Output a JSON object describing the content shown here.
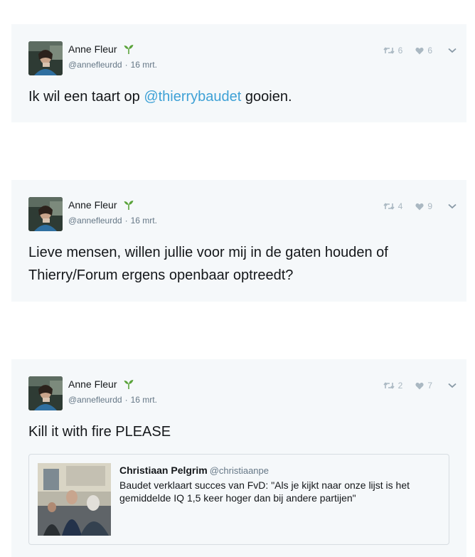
{
  "tweets": [
    {
      "author_name": "Anne Fleur",
      "handle": "@annefleurdd",
      "separator": "·",
      "date": "16 mrt.",
      "retweets": "6",
      "likes": "6",
      "text_before": "Ik wil een taart op ",
      "mention": "@thierrybaudet",
      "text_after": " gooien."
    },
    {
      "author_name": "Anne Fleur",
      "handle": "@annefleurdd",
      "separator": "·",
      "date": "16 mrt.",
      "retweets": "4",
      "likes": "9",
      "text": "Lieve mensen, willen jullie voor mij in de gaten houden of Thierry/Forum ergens openbaar optreedt?"
    },
    {
      "author_name": "Anne Fleur",
      "handle": "@annefleurdd",
      "separator": "·",
      "date": "16 mrt.",
      "retweets": "2",
      "likes": "7",
      "text": "Kill it with fire PLEASE",
      "quote": {
        "author_name": "Christiaan Pelgrim",
        "handle": "@christiaanpe",
        "text": "Baudet verklaart succes van FvD: \"Als je kijkt naar onze lijst is het gemiddelde IQ 1,5 keer hoger dan bij andere partijen\""
      }
    }
  ],
  "icons": {
    "retweet": "retweet-icon",
    "like": "heart-icon",
    "more": "chevron-down-icon",
    "badge": "sprout-icon"
  },
  "colors": {
    "card_background": "#f5f8fa",
    "mention": "#3ea1d6",
    "muted": "#657786",
    "action_icons": "#aab8c2",
    "sprout": "#5aa33a"
  }
}
